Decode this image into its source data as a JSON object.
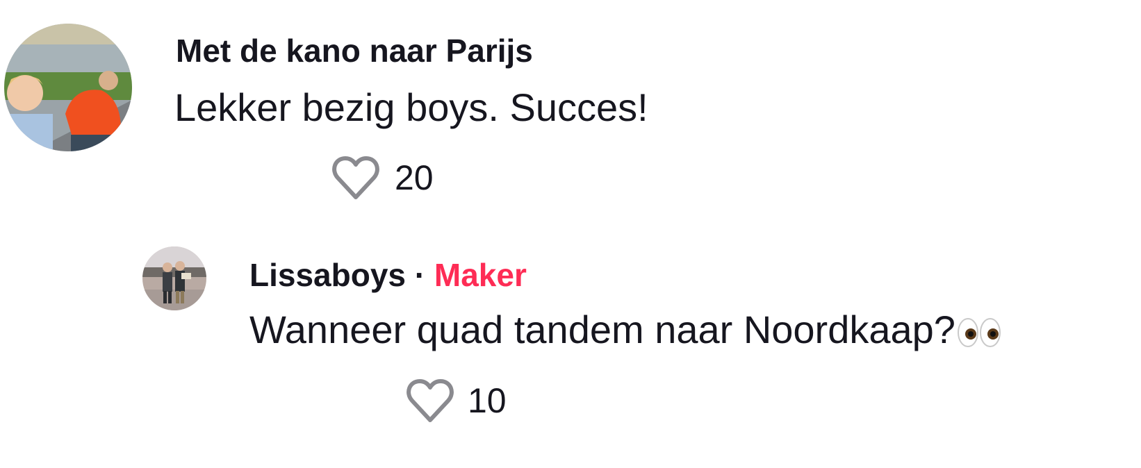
{
  "comments": [
    {
      "username": "Met de kano naar Parijs",
      "text": "Lekker bezig boys. Succes!",
      "likes": "20",
      "like_icon": "heart-outline-icon",
      "avatar": "photo-avatar"
    },
    {
      "username": "Lissaboys",
      "separator": "·",
      "badge": "Maker",
      "text": "Wanneer quad tandem naar Noordkaap?",
      "emoji": "👀",
      "likes": "10",
      "like_icon": "heart-outline-icon",
      "avatar": "photo-avatar"
    }
  ],
  "colors": {
    "text": "#16161f",
    "maker": "#fe2c55",
    "icon": "#8a8a8f"
  }
}
